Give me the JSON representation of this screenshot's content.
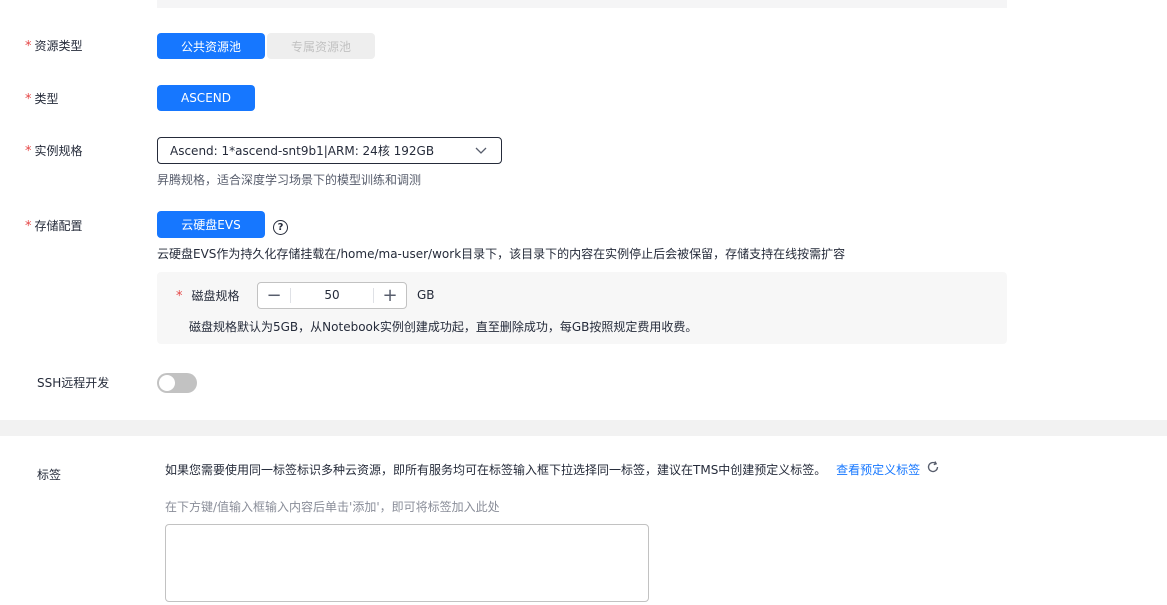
{
  "resource_type": {
    "label": "资源类型",
    "options": [
      "公共资源池",
      "专属资源池"
    ],
    "selected": "公共资源池"
  },
  "type": {
    "label": "类型",
    "value": "ASCEND"
  },
  "instance_spec": {
    "label": "实例规格",
    "selected": "Ascend: 1*ascend-snt9b1|ARM: 24核 192GB",
    "hint": "昇腾规格，适合深度学习场景下的模型训练和调测"
  },
  "storage": {
    "label": "存储配置",
    "option": "云硬盘EVS",
    "hint": "云硬盘EVS作为持久化存储挂载在/home/ma-user/work目录下，该目录下的内容在实例停止后会被保留，存储支持在线按需扩容",
    "disk": {
      "label": "磁盘规格",
      "value": "50",
      "unit": "GB",
      "hint": "磁盘规格默认为5GB，从Notebook实例创建成功起，直至删除成功，每GB按照规定费用收费。"
    }
  },
  "ssh": {
    "label": "SSH远程开发",
    "enabled": false
  },
  "tags": {
    "label": "标签",
    "info": "如果您需要使用同一标签标识多种云资源，即所有服务均可在标签输入框下拉选择同一标签，建议在TMS中创建预定义标签。",
    "link": "查看预定义标签",
    "hint": "在下方键/值输入框输入内容后单击'添加'，即可将标签加入此处"
  },
  "colors": {
    "primary": "#1677ff",
    "required": "#e54545"
  }
}
